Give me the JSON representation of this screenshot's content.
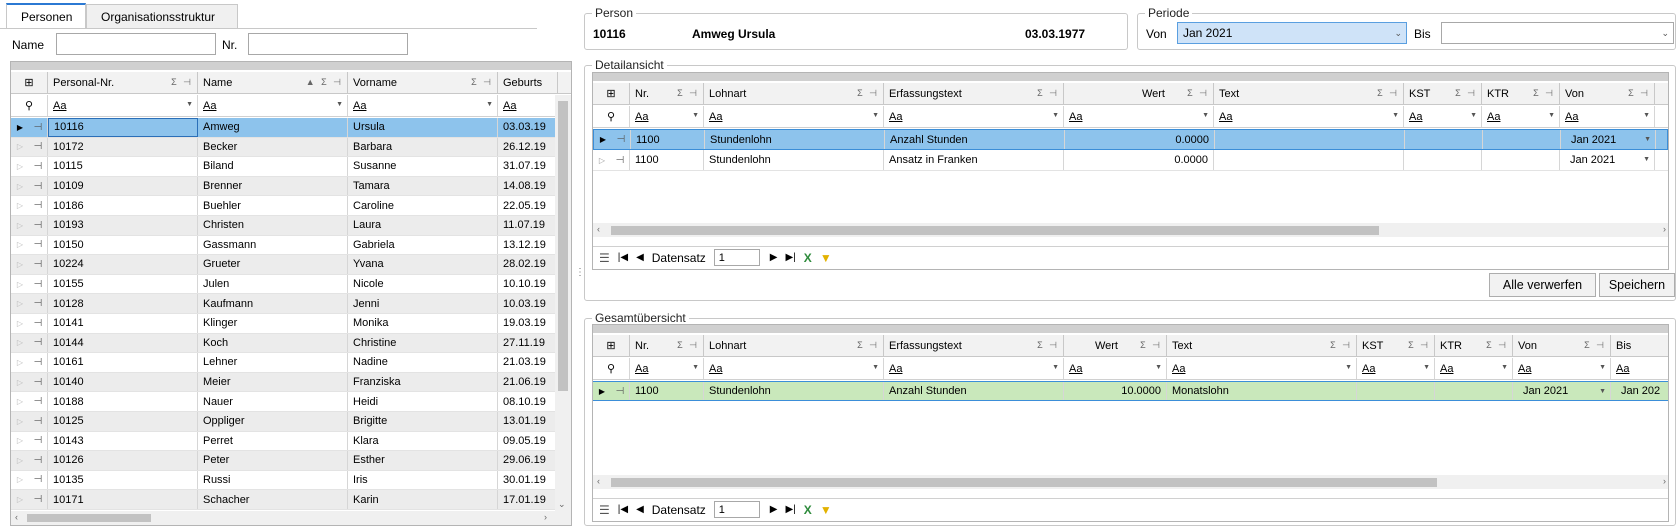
{
  "tabs": {
    "personen": "Personen",
    "org": "Organisationsstruktur"
  },
  "search": {
    "name_label": "Name",
    "nr_label": "Nr.",
    "name_value": "",
    "nr_value": ""
  },
  "filter_placeholder": "Aa",
  "persons": {
    "columns": [
      "Personal-Nr.",
      "Name",
      "Vorname",
      "Geburts"
    ],
    "rows": [
      {
        "nr": "10116",
        "name": "Amweg",
        "vorname": "Ursula",
        "geb": "03.03.19"
      },
      {
        "nr": "10172",
        "name": "Becker",
        "vorname": "Barbara",
        "geb": "26.12.19"
      },
      {
        "nr": "10115",
        "name": "Biland",
        "vorname": "Susanne",
        "geb": "31.07.19"
      },
      {
        "nr": "10109",
        "name": "Brenner",
        "vorname": "Tamara",
        "geb": "14.08.19"
      },
      {
        "nr": "10186",
        "name": "Buehler",
        "vorname": "Caroline",
        "geb": "22.05.19"
      },
      {
        "nr": "10193",
        "name": "Christen",
        "vorname": "Laura",
        "geb": "11.07.19"
      },
      {
        "nr": "10150",
        "name": "Gassmann",
        "vorname": "Gabriela",
        "geb": "13.12.19"
      },
      {
        "nr": "10224",
        "name": "Grueter",
        "vorname": "Yvana",
        "geb": "28.02.19"
      },
      {
        "nr": "10155",
        "name": "Julen",
        "vorname": "Nicole",
        "geb": "10.10.19"
      },
      {
        "nr": "10128",
        "name": "Kaufmann",
        "vorname": "Jenni",
        "geb": "10.03.19"
      },
      {
        "nr": "10141",
        "name": "Klinger",
        "vorname": "Monika",
        "geb": "19.03.19"
      },
      {
        "nr": "10144",
        "name": "Koch",
        "vorname": "Christine",
        "geb": "27.11.19"
      },
      {
        "nr": "10161",
        "name": "Lehner",
        "vorname": "Nadine",
        "geb": "21.03.19"
      },
      {
        "nr": "10140",
        "name": "Meier",
        "vorname": "Franziska",
        "geb": "21.06.19"
      },
      {
        "nr": "10188",
        "name": "Nauer",
        "vorname": "Heidi",
        "geb": "08.10.19"
      },
      {
        "nr": "10125",
        "name": "Oppliger",
        "vorname": "Brigitte",
        "geb": "13.01.19"
      },
      {
        "nr": "10143",
        "name": "Perret",
        "vorname": "Klara",
        "geb": "09.05.19"
      },
      {
        "nr": "10126",
        "name": "Peter",
        "vorname": "Esther",
        "geb": "29.06.19"
      },
      {
        "nr": "10135",
        "name": "Russi",
        "vorname": "Iris",
        "geb": "30.01.19"
      },
      {
        "nr": "10171",
        "name": "Schacher",
        "vorname": "Karin",
        "geb": "17.01.19"
      }
    ]
  },
  "person": {
    "title": "Person",
    "nr": "10116",
    "name": "Amweg Ursula",
    "birthdate": "03.03.1977"
  },
  "periode": {
    "title": "Periode",
    "von_label": "Von",
    "von_value": "Jan 2021",
    "bis_label": "Bis",
    "bis_value": ""
  },
  "detail": {
    "title": "Detailansicht",
    "columns": [
      "Nr.",
      "Lohnart",
      "Erfassungstext",
      "Wert",
      "Text",
      "KST",
      "KTR",
      "Von"
    ],
    "rows": [
      {
        "nr": "1100",
        "lohnart": "Stundenlohn",
        "text1": "Anzahl Stunden",
        "wert": "0.0000",
        "text": "",
        "kst": "",
        "ktr": "",
        "von": "Jan 2021"
      },
      {
        "nr": "1100",
        "lohnart": "Stundenlohn",
        "text1": "Ansatz in Franken",
        "wert": "0.0000",
        "text": "",
        "kst": "",
        "ktr": "",
        "von": "Jan 2021"
      }
    ],
    "nav_label": "Datensatz",
    "nav_value": "1"
  },
  "buttons": {
    "discard": "Alle verwerfen",
    "save": "Speichern"
  },
  "overview": {
    "title": "Gesamtübersicht",
    "columns": [
      "Nr.",
      "Lohnart",
      "Erfassungstext",
      "Wert",
      "Text",
      "KST",
      "KTR",
      "Von",
      "Bis"
    ],
    "rows": [
      {
        "nr": "1100",
        "lohnart": "Stundenlohn",
        "text1": "Anzahl Stunden",
        "wert": "10.0000",
        "text": "Monatslohn",
        "kst": "",
        "ktr": "",
        "von": "Jan 2021",
        "bis": "Jan 202"
      }
    ],
    "nav_label": "Datensatz",
    "nav_value": "1"
  },
  "colors": {
    "selection": "#8dc3ec",
    "overview_row": "#c9e8bb",
    "tab_accent": "#2b79d3"
  }
}
